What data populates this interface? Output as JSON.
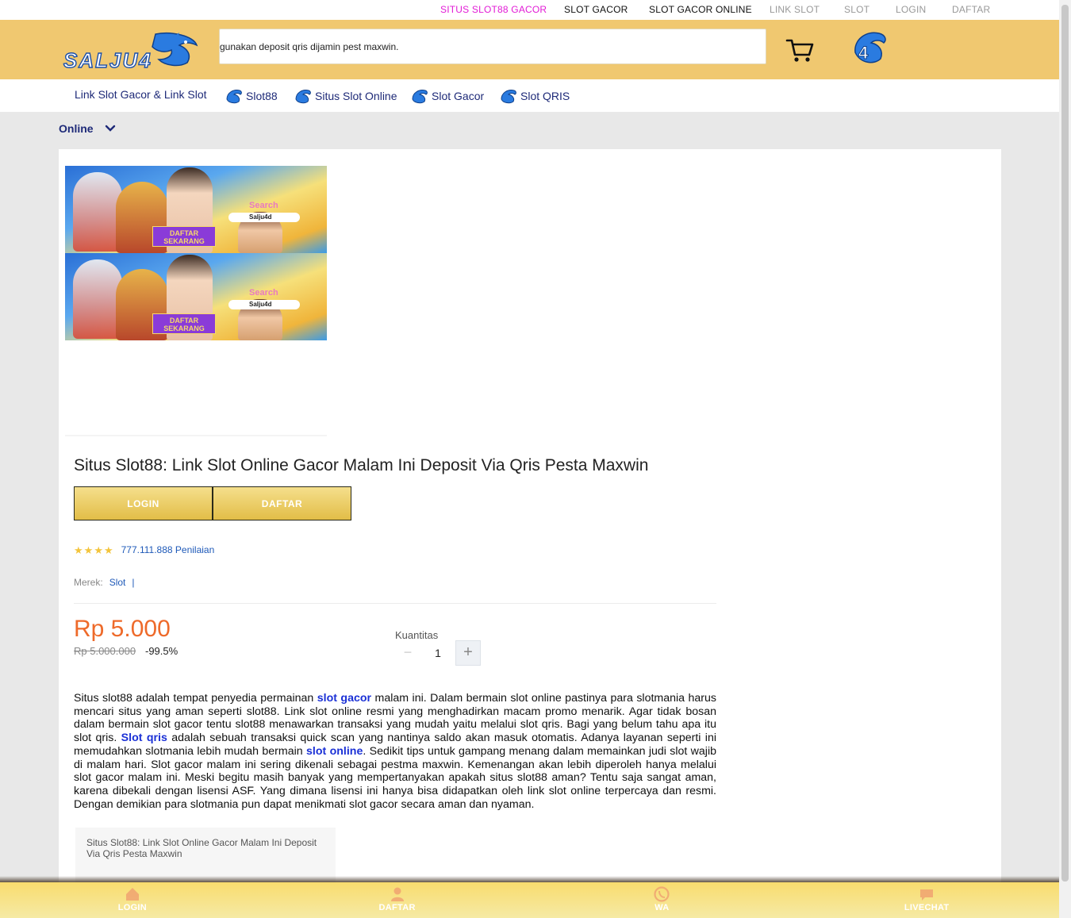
{
  "top_links": [
    {
      "label": "SITUS SLOT88 GACOR",
      "color": "#e21bd6"
    },
    {
      "label": "SLOT GACOR",
      "color": "#111111"
    },
    {
      "label": "SLOT GACOR ONLINE",
      "color": "#111111"
    },
    {
      "label": "LINK SLOT",
      "color": "#999999"
    },
    {
      "label": "SLOT",
      "color": "#999999"
    },
    {
      "label": "LOGIN",
      "color": "#999999"
    },
    {
      "label": "DAFTAR",
      "color": "#999999"
    }
  ],
  "header": {
    "logo_text": "SALJU4",
    "search_text": "gunakan deposit qris dijamin pest maxwin.",
    "cart_icon": "cart-icon",
    "badge_text": "4"
  },
  "nav": {
    "items": [
      {
        "label": "Link Slot Gacor & Link Slot",
        "icon": false
      },
      {
        "label": "Slot88",
        "icon": true
      },
      {
        "label": "Situs Slot Online",
        "icon": true
      },
      {
        "label": "Slot Gacor",
        "icon": true
      },
      {
        "label": "Slot QRIS",
        "icon": true
      }
    ]
  },
  "breadcrumb": {
    "label": "Online"
  },
  "banner": {
    "search_label": "Search",
    "pill_text": "Salju4d",
    "cta_line1": "DAFTAR",
    "cta_line2": "SEKARANG"
  },
  "product": {
    "title": "Situs Slot88: Link Slot Online Gacor Malam Ini Deposit Via Qris Pesta Maxwin",
    "login_label": "LOGIN",
    "daftar_label": "DAFTAR",
    "rating_stars": 4,
    "rating_count": "777.111.888 Penilaian",
    "brand_label": "Merek:",
    "brand_value": "Slot",
    "brand_sep": "|",
    "price": "Rp 5.000",
    "old_price": "Rp 5.000.000",
    "discount": "-99.5%",
    "qty_label": "Kuantitas",
    "qty_value": "1",
    "qty_minus": "−",
    "qty_plus": "+"
  },
  "description": {
    "parts": [
      {
        "t": "Situs slot88 adalah tempat penyedia permainan "
      },
      {
        "t": "slot gacor",
        "link": true
      },
      {
        "t": " malam ini. Dalam bermain slot online pastinya para slotmania harus mencari situs yang aman seperti slot88. Link slot online resmi yang menghadirkan macam promo menarik. Agar tidak bosan dalam bermain slot gacor tentu slot88 menawarkan transaksi yang mudah yaitu melalui slot qris. Bagi yang belum tahu apa itu slot qris. "
      },
      {
        "t": "Slot qris",
        "link": true
      },
      {
        "t": " adalah sebuah transaksi quick scan yang nantinya saldo akan masuk otomatis. Adanya layanan seperti ini memudahkan slotmania lebih mudah bermain "
      },
      {
        "t": "slot online",
        "link": true
      },
      {
        "t": ". Sedikit tips untuk gampang menang dalam memainkan judi slot wajib di malam hari. Slot gacor malam ini sering dikenali sebagai pestma maxwin. Kemenangan akan lebih diperoleh hanya melalui slot gacor malam ini. Meski begitu masih banyak yang mempertanyakan apakah situs slot88 aman? Tentu saja sangat aman, karena dibekali dengan lisensi ASF. Yang dimana lisensi ini hanya bisa didapatkan oleh link slot online terpercaya dan resmi. Dengan demikian para slotmania pun dapat menikmati slot gacor secara aman dan nyaman."
      }
    ]
  },
  "mini_card": {
    "text": "Situs Slot88: Link Slot Online Gacor Malam Ini Deposit Via Qris Pesta Maxwin"
  },
  "bottom_bar": [
    {
      "label": "LOGIN",
      "icon": "home-icon"
    },
    {
      "label": "DAFTAR",
      "icon": "user-icon"
    },
    {
      "label": "WA",
      "icon": "whatsapp-icon"
    },
    {
      "label": "LIVECHAT",
      "icon": "chat-icon"
    }
  ]
}
